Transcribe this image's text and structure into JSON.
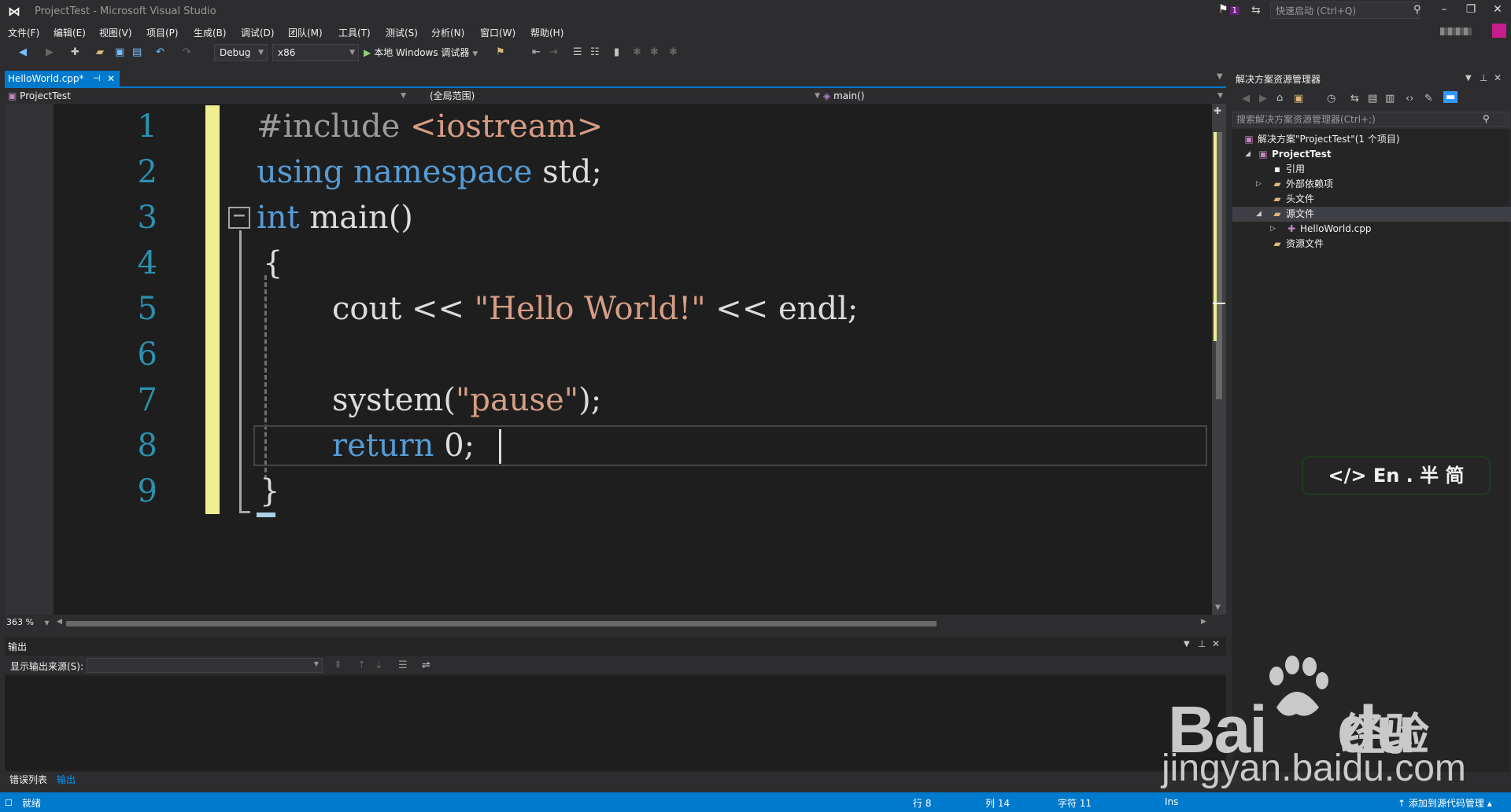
{
  "window": {
    "title": "ProjectTest - Microsoft Visual Studio",
    "notification_count": "1",
    "quick_launch_placeholder": "快速启动 (Ctrl+Q)"
  },
  "menu": [
    "文件(F)",
    "编辑(E)",
    "视图(V)",
    "项目(P)",
    "生成(B)",
    "调试(D)",
    "团队(M)",
    "工具(T)",
    "测试(S)",
    "分析(N)",
    "窗口(W)",
    "帮助(H)"
  ],
  "toolbar": {
    "config": "Debug",
    "platform": "x86",
    "run_label": "本地 Windows 调试器"
  },
  "editor": {
    "tab_label": "HelloWorld.cpp*",
    "nav_project": "ProjectTest",
    "nav_scope": "(全局范围)",
    "nav_function": "main()",
    "line_numbers": [
      "1",
      "2",
      "3",
      "4",
      "5",
      "6",
      "7",
      "8",
      "9"
    ],
    "lines": {
      "l1_pp": "#include",
      "l1_inc": " <iostream>",
      "l2_kw": "using namespace",
      "l2_rest": " std;",
      "l3_kw": "int",
      "l3_rest": " main()",
      "l4": "{",
      "l5_a": "cout << ",
      "l5_str": "\"Hello World!\"",
      "l5_b": " << endl;",
      "l7_a": "system(",
      "l7_str": "\"pause\"",
      "l7_b": ");",
      "l8_kw": "return",
      "l8_rest": " 0;",
      "l9": "}"
    },
    "zoom": "363 %"
  },
  "output": {
    "title": "输出",
    "source_label": "显示输出来源(S):",
    "source_value": ""
  },
  "bottom_tabs": [
    "错误列表",
    "输出"
  ],
  "solution_explorer": {
    "title": "解决方案资源管理器",
    "search_placeholder": "搜索解决方案资源管理器(Ctrl+;)",
    "items": [
      {
        "label": "解决方案\"ProjectTest\"(1 个项目)",
        "level": 0
      },
      {
        "label": "ProjectTest",
        "level": 1
      },
      {
        "label": "引用",
        "level": 2
      },
      {
        "label": "外部依赖项",
        "level": 2
      },
      {
        "label": "头文件",
        "level": 2
      },
      {
        "label": "源文件",
        "level": 2
      },
      {
        "label": "HelloWorld.cpp",
        "level": 3
      },
      {
        "label": "资源文件",
        "level": 2
      }
    ]
  },
  "ime": "</> En . 半 简",
  "watermark": {
    "brand": "Bai",
    "brand2": "du",
    "jingyan": "经验",
    "url": "jingyan.baidu.com"
  },
  "status": {
    "ready": "就绪",
    "line": "行 8",
    "col": "列 14",
    "char": "字符 11",
    "mode": "Ins",
    "source_control": "添加到源代码管理"
  },
  "colors": {
    "accent": "#007acc",
    "keyword": "#569cd6",
    "string": "#d69d85",
    "line_number": "#2b91af",
    "change_bar": "#efef91"
  }
}
